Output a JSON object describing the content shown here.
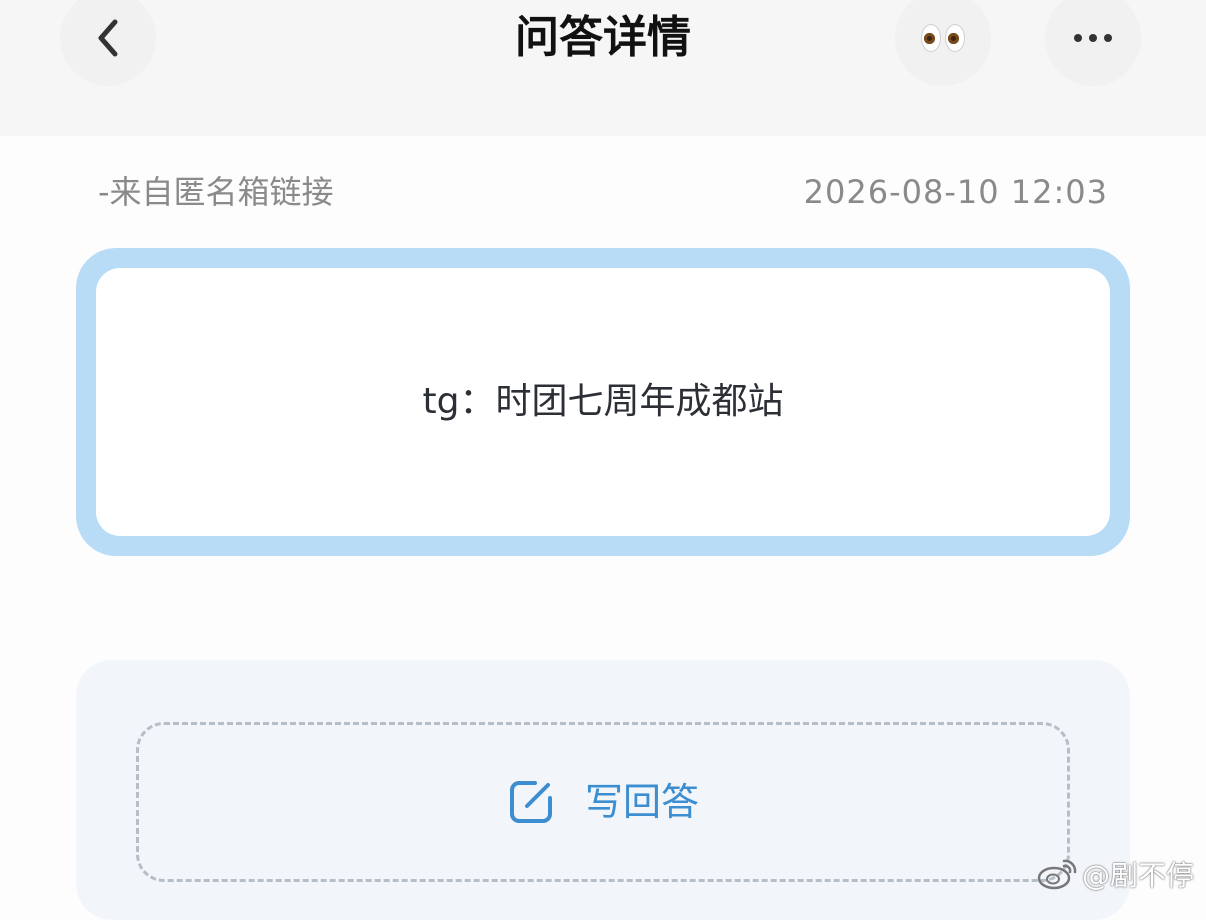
{
  "header": {
    "title": "问答详情",
    "back_icon": "chevron-left-icon",
    "eyes_icon": "eyes-icon",
    "more_icon": "more-horizontal-icon"
  },
  "meta": {
    "source": "-来自匿名箱链接",
    "timestamp": "2026-08-10 12:03"
  },
  "question": {
    "text": "tg：时团七周年成都站"
  },
  "answer": {
    "write_label": "写回答",
    "write_icon": "edit-icon"
  },
  "watermark": {
    "text": "@剧不停"
  },
  "colors": {
    "card_border": "#b8dcf6",
    "accent": "#3d8ed0",
    "answer_bg": "#f2f6fb",
    "muted_text": "#8a8a8a"
  }
}
